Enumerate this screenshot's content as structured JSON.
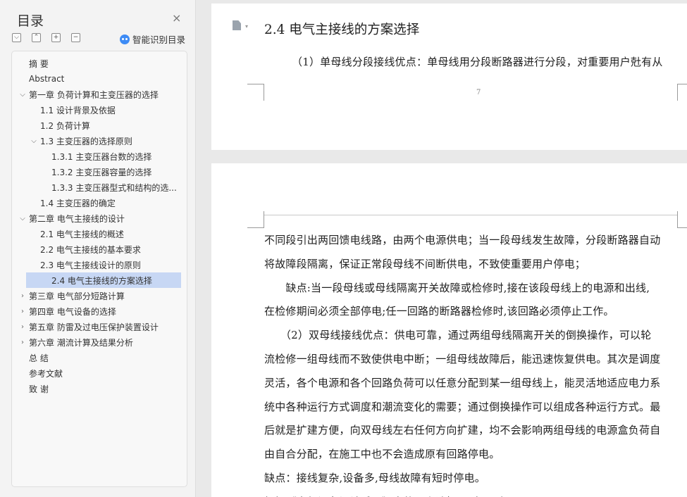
{
  "toc": {
    "title": "目录",
    "close_symbol": "×",
    "tools": [
      "⌵",
      "⌃",
      "+",
      "−"
    ],
    "smart_label": "智能识别目录",
    "items": [
      {
        "label": "摘  要",
        "level": 0,
        "chevron": ""
      },
      {
        "label": "Abstract",
        "level": 0,
        "chevron": ""
      },
      {
        "label": "第一章  负荷计算和主变压器的选择",
        "level": 0,
        "chevron": "⌵"
      },
      {
        "label": "1.1 设计背景及依据",
        "level": 1,
        "chevron": ""
      },
      {
        "label": "1.2 负荷计算",
        "level": 1,
        "chevron": ""
      },
      {
        "label": "1.3 主变压器的选择原则",
        "level": 1,
        "chevron": "⌵"
      },
      {
        "label": "1.3.1 主变压器台数的选择",
        "level": 2,
        "chevron": ""
      },
      {
        "label": "1.3.2 主变压器容量的选择",
        "level": 2,
        "chevron": ""
      },
      {
        "label": "1.3.3 主变压器型式和结构的选...",
        "level": 2,
        "chevron": ""
      },
      {
        "label": "1.4 主变压器的确定",
        "level": 1,
        "chevron": ""
      },
      {
        "label": "第二章  电气主接线的设计",
        "level": 0,
        "chevron": "⌵"
      },
      {
        "label": "2.1 电气主接线的概述",
        "level": 1,
        "chevron": ""
      },
      {
        "label": "2.2 电气主接线的基本要求",
        "level": 1,
        "chevron": ""
      },
      {
        "label": "2.3 电气主接线设计的原则",
        "level": 1,
        "chevron": ""
      },
      {
        "label": "2.4 电气主接线的方案选择",
        "level": 1,
        "chevron": "",
        "selected": true
      },
      {
        "label": "第三章  电气部分短路计算",
        "level": 0,
        "chevron": "›"
      },
      {
        "label": "第四章  电气设备的选择",
        "level": 0,
        "chevron": "›"
      },
      {
        "label": "第五章  防雷及过电压保护装置设计",
        "level": 0,
        "chevron": "›"
      },
      {
        "label": "第六章  潮流计算及结果分析",
        "level": 0,
        "chevron": "›"
      },
      {
        "label": "总  结",
        "level": 0,
        "chevron": ""
      },
      {
        "label": "参考文献",
        "level": 0,
        "chevron": ""
      },
      {
        "label": "致  谢",
        "level": 0,
        "chevron": ""
      }
    ]
  },
  "document": {
    "page1": {
      "heading": "2.4 电气主接线的方案选择",
      "line1": "（1）单母线分段接线优点：单母线用分段断路器进行分段，对重要用户兙有从",
      "page_number": "7"
    },
    "page2": {
      "lines": [
        "不同段引出两回馈电线路，由两个电源供电；当一段母线发生故障，分段断路器自动",
        "将故障段隔离，保证正常段母线不间断供电，不致使重要用户停电；",
        "　　缺点:当一段母线或母线隔离开关故障或检修时,接在该段母线上的电源和出线,",
        "在检修期间必须全部停电;任一回路的断路器检修时,该回路必须停止工作。",
        "　　（2）双母线接线优点：供电可靠，通过两组母线隔离开关的倒换操作，可以轮",
        "流检修一组母线而不致使供电中断；一组母线故障后，能迅速恢复供电。其次是调度",
        "灵活，各个电源和各个回路负荷可以任意分配到某一组母线上，能灵活地适应电力系",
        "统中各种运行方式调度和潮流变化的需要；通过倒换操作可以组成各种运行方式。最",
        "后就是扩建方便，向双母线左右任何方向扩建，均不会影响两组母线的电源盒负荷自",
        "由自合分配，在施工中也不会造成原有回路停电。",
        "缺点：接线复杂,设备多,母线故障有短时停电。",
        "根据《电气设备设计手册》中的以上选择原则，可知。"
      ]
    }
  }
}
